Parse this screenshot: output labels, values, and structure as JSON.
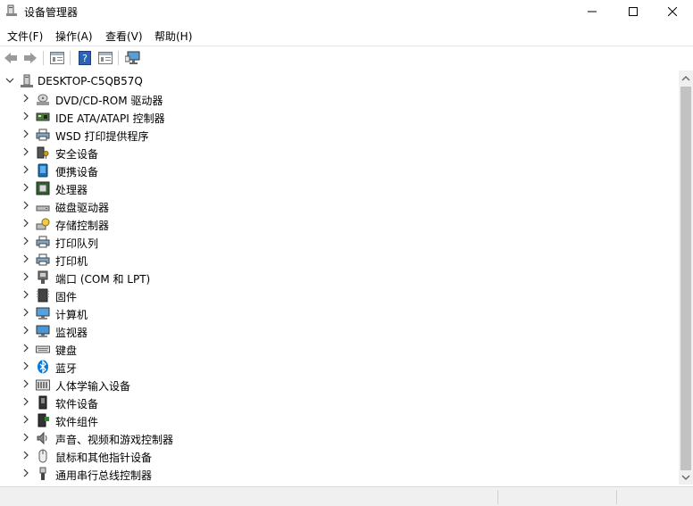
{
  "window": {
    "title": "设备管理器",
    "minimize_icon": "minimize-icon",
    "maximize_icon": "maximize-icon",
    "close_icon": "close-icon"
  },
  "menu": [
    {
      "label": "文件(F)"
    },
    {
      "label": "操作(A)"
    },
    {
      "label": "查看(V)"
    },
    {
      "label": "帮助(H)"
    }
  ],
  "toolbar": {
    "buttons": [
      "back-arrow-icon",
      "forward-arrow-icon",
      "properties-icon",
      "help-icon",
      "view-icon",
      "monitor-scan-icon"
    ]
  },
  "tree": {
    "root": {
      "label": "DESKTOP-C5QB57Q",
      "icon": "computer-tower-icon",
      "expanded": true
    },
    "categories": [
      {
        "label": "DVD/CD-ROM 驱动器",
        "icon": "dvd-drive-icon"
      },
      {
        "label": "IDE ATA/ATAPI 控制器",
        "icon": "ide-controller-icon"
      },
      {
        "label": "WSD 打印提供程序",
        "icon": "printer-icon"
      },
      {
        "label": "安全设备",
        "icon": "security-device-icon"
      },
      {
        "label": "便携设备",
        "icon": "portable-device-icon"
      },
      {
        "label": "处理器",
        "icon": "processor-icon"
      },
      {
        "label": "磁盘驱动器",
        "icon": "disk-drive-icon"
      },
      {
        "label": "存储控制器",
        "icon": "storage-controller-icon"
      },
      {
        "label": "打印队列",
        "icon": "print-queue-icon"
      },
      {
        "label": "打印机",
        "icon": "printer-icon"
      },
      {
        "label": "端口 (COM 和 LPT)",
        "icon": "port-icon"
      },
      {
        "label": "固件",
        "icon": "firmware-icon"
      },
      {
        "label": "计算机",
        "icon": "computer-icon"
      },
      {
        "label": "监视器",
        "icon": "monitor-icon"
      },
      {
        "label": "键盘",
        "icon": "keyboard-icon"
      },
      {
        "label": "蓝牙",
        "icon": "bluetooth-icon"
      },
      {
        "label": "人体学输入设备",
        "icon": "hid-icon"
      },
      {
        "label": "软件设备",
        "icon": "software-device-icon"
      },
      {
        "label": "软件组件",
        "icon": "software-component-icon"
      },
      {
        "label": "声音、视频和游戏控制器",
        "icon": "speaker-icon"
      },
      {
        "label": "鼠标和其他指针设备",
        "icon": "mouse-icon"
      },
      {
        "label": "通用串行总线控制器",
        "icon": "usb-icon"
      }
    ]
  },
  "colors": {
    "accent": "#1a6fb5",
    "bluetooth": "#0a78d7",
    "scroll_thumb": "#c2c2c2"
  }
}
